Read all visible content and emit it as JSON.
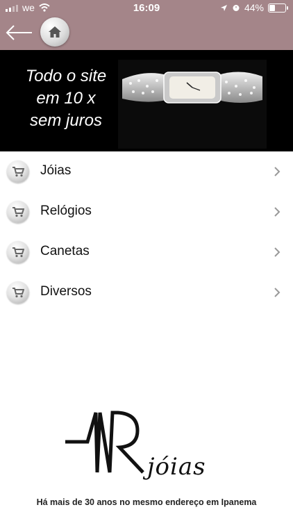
{
  "status_bar": {
    "carrier": "we",
    "time": "16:09",
    "battery": "44%"
  },
  "banner": {
    "line1": "Todo o site",
    "line2": "em 10 x",
    "line3": "sem juros"
  },
  "menu": [
    {
      "label": "Jóias"
    },
    {
      "label": "Relógios"
    },
    {
      "label": "Canetas"
    },
    {
      "label": "Diversos"
    }
  ],
  "brand": {
    "script": "jóias",
    "tagline": "Há mais de 30 anos no mesmo endereço em Ipanema"
  },
  "colors": {
    "header_bg": "#a48589",
    "banner_bg": "#000000"
  }
}
